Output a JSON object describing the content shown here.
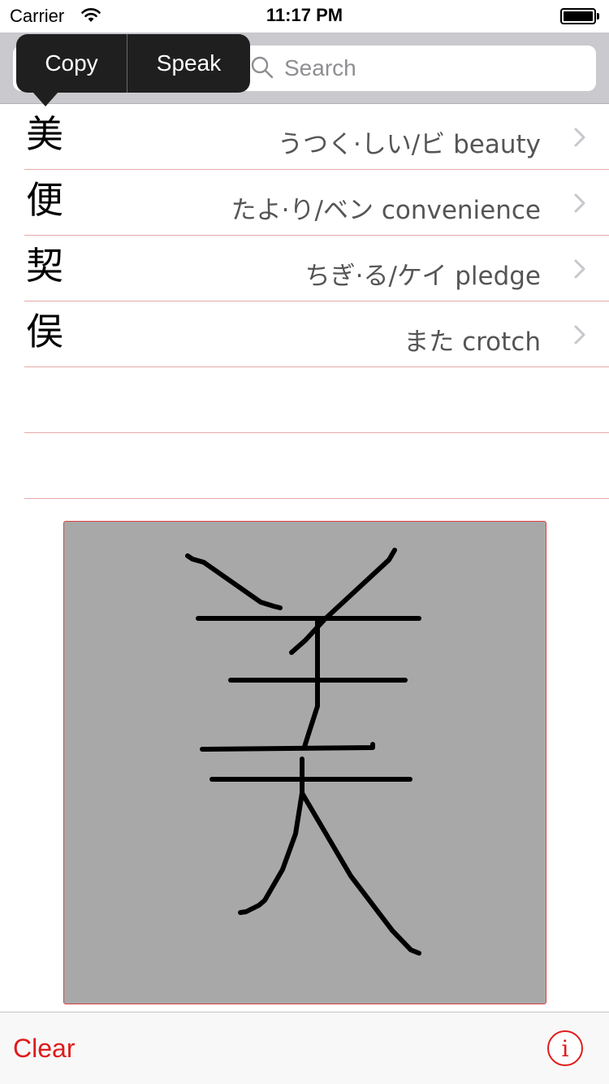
{
  "status_bar": {
    "carrier": "Carrier",
    "time": "11:17 PM",
    "icons": [
      "wifi-icon",
      "battery-icon"
    ]
  },
  "search": {
    "placeholder": "Search",
    "value": "",
    "icon": "search-icon"
  },
  "popup_menu": {
    "items": [
      {
        "label": "Copy"
      },
      {
        "label": "Speak"
      }
    ]
  },
  "results": [
    {
      "kanji": "美",
      "detail": "うつく·しい/ビ beauty"
    },
    {
      "kanji": "便",
      "detail": "たよ·り/ベン convenience"
    },
    {
      "kanji": "契",
      "detail": "ちぎ·る/ケイ pledge"
    },
    {
      "kanji": "俣",
      "detail": "また crotch"
    }
  ],
  "empty_rows": 2,
  "toolbar": {
    "clear_label": "Clear",
    "info_icon": "info-icon",
    "info_glyph": "i"
  },
  "colors": {
    "accent": "#e01b1b",
    "separator": "#e7a9a9",
    "canvas_bg": "#a8a8a8",
    "search_bar_bg": "#c9c9ce",
    "popup_bg": "#1f1f1f"
  }
}
